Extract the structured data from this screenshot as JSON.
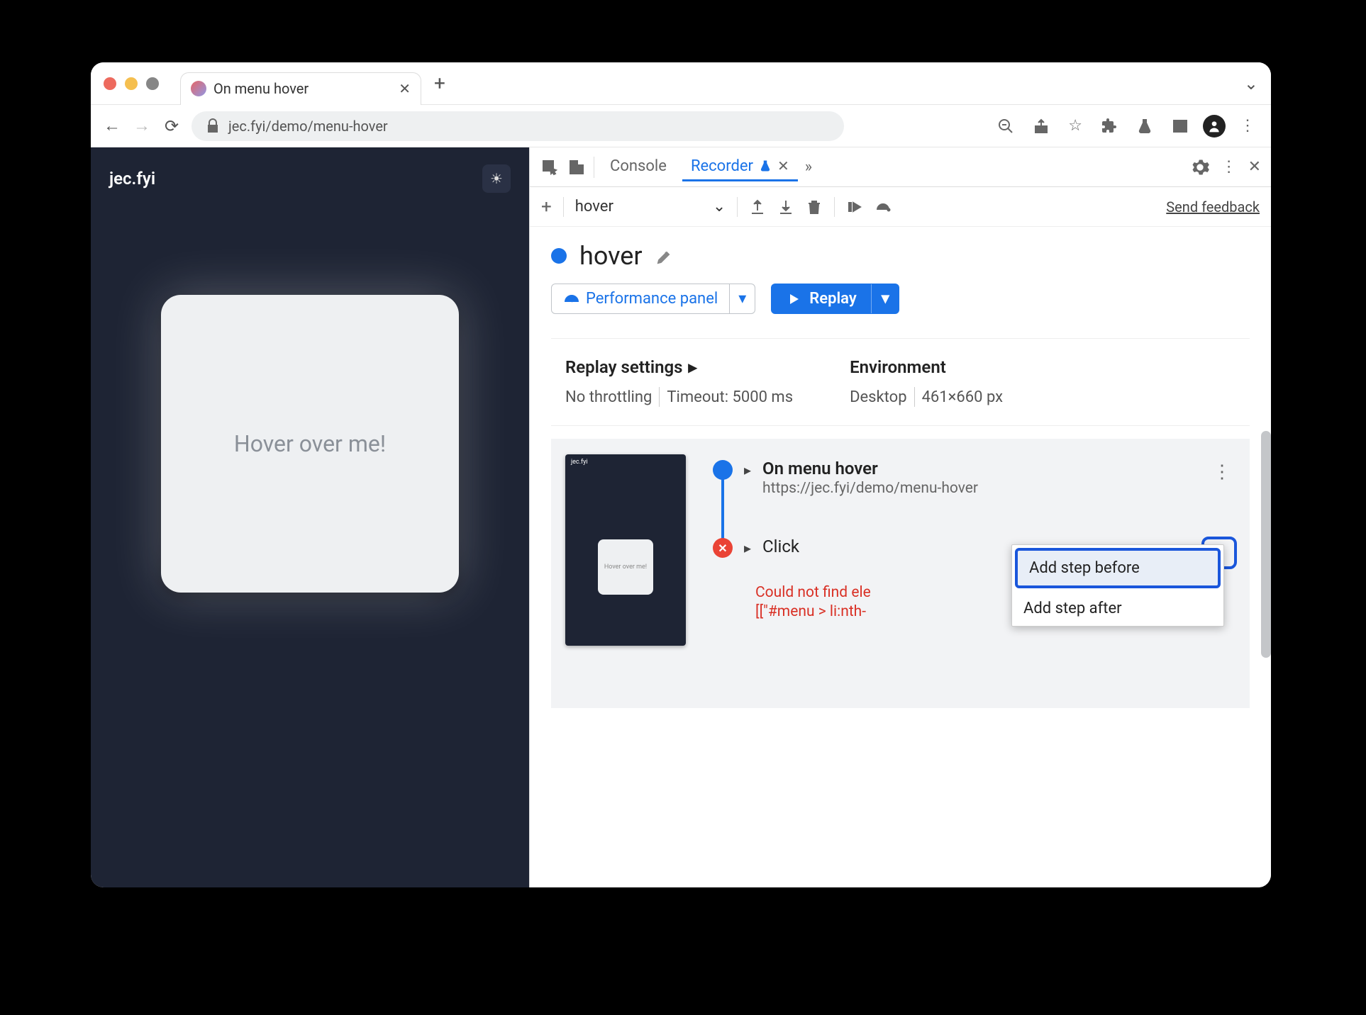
{
  "browser": {
    "tab_title": "On menu hover",
    "url_display": "jec.fyi/demo/menu-hover"
  },
  "page": {
    "brand": "jec.fyi",
    "hover_text": "Hover over me!"
  },
  "devtools": {
    "tabs": {
      "console": "Console",
      "recorder": "Recorder"
    },
    "recorder_toolbar": {
      "recording_select": "hover",
      "feedback": "Send feedback"
    },
    "recording": {
      "title": "hover",
      "perf_button": "Performance panel",
      "replay_button": "Replay",
      "replay_settings_label": "Replay settings",
      "throttling": "No throttling",
      "timeout": "Timeout: 5000 ms",
      "env_label": "Environment",
      "env_device": "Desktop",
      "env_viewport": "461×660 px"
    },
    "steps": {
      "step1_title": "On menu hover",
      "step1_sub": "https://jec.fyi/demo/menu-hover",
      "step2_title": "Click",
      "error_line1": "Could not find ele",
      "error_line2": "[[\"#menu > li:nth-"
    },
    "context_menu": {
      "before": "Add step before",
      "after": "Add step after"
    }
  },
  "mini_text": "Hover over me!"
}
